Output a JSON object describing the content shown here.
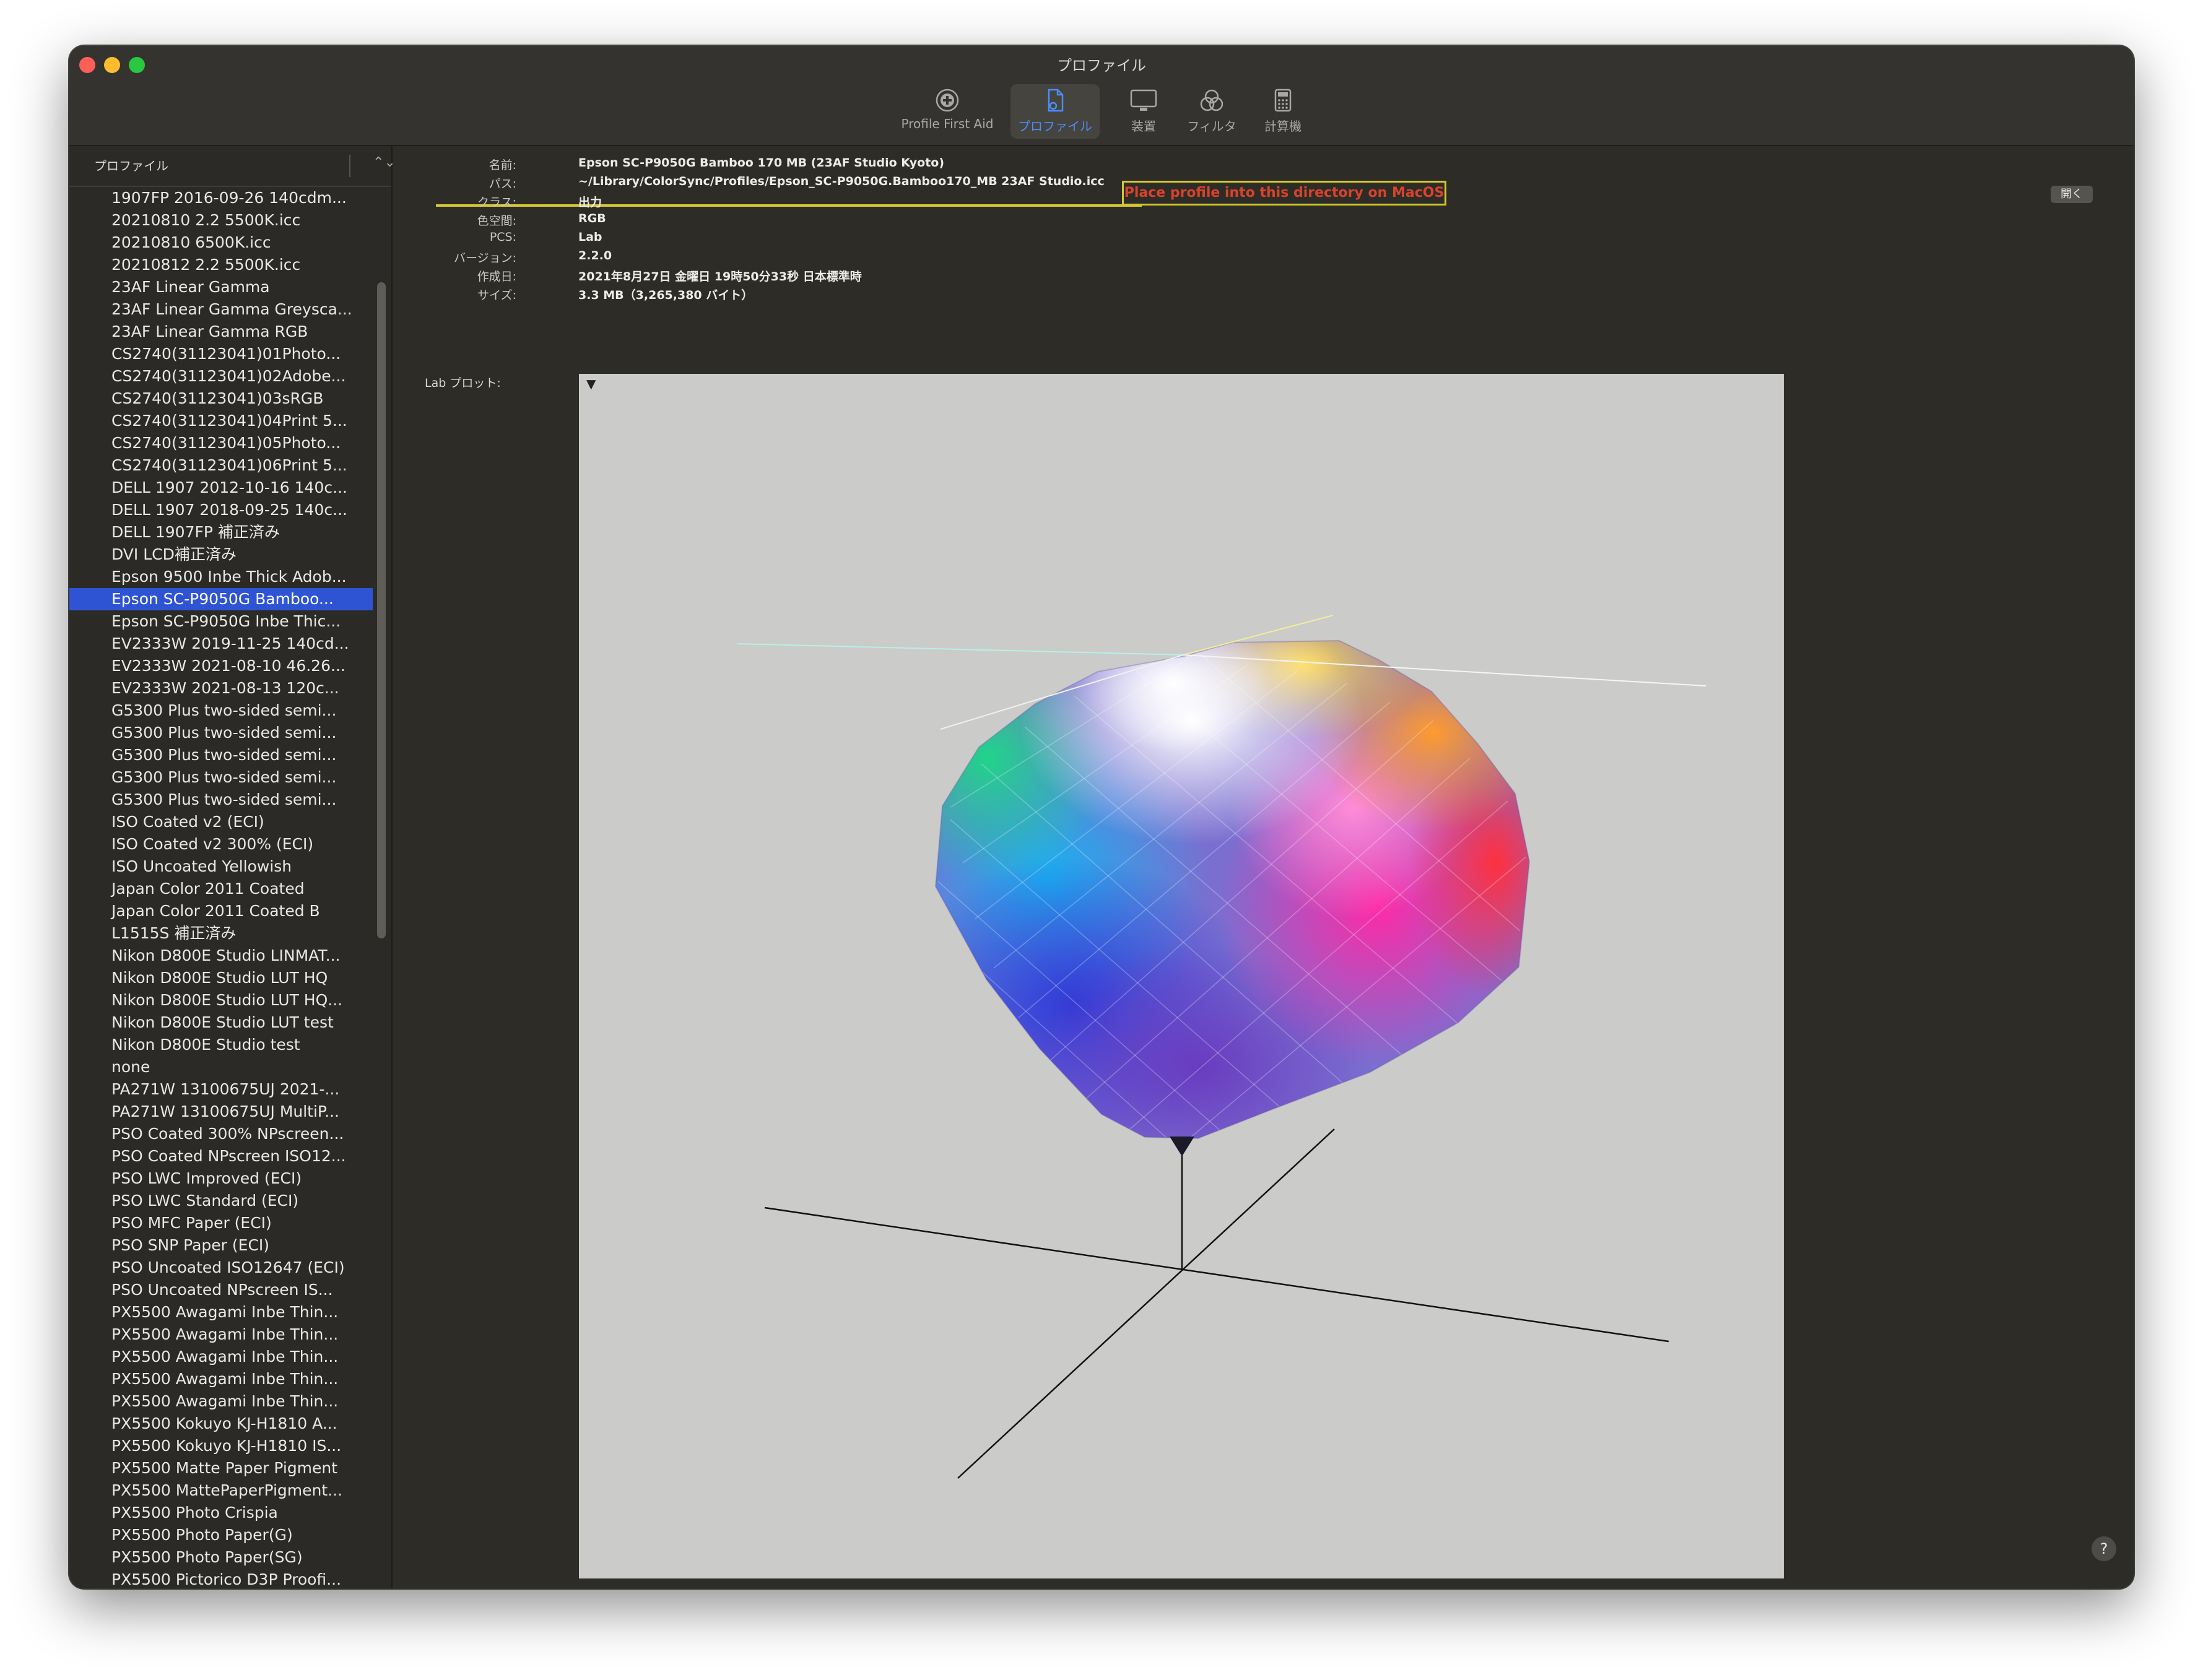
{
  "window": {
    "title": "プロファイル"
  },
  "toolbar": {
    "tools": [
      {
        "label": "Profile First Aid",
        "icon": "plus-circle-icon"
      },
      {
        "label": "プロファイル",
        "icon": "document-gear-icon",
        "active": true
      },
      {
        "label": "装置",
        "icon": "monitor-icon"
      },
      {
        "label": "フィルタ",
        "icon": "color-circles-icon"
      },
      {
        "label": "計算機",
        "icon": "calculator-icon"
      }
    ]
  },
  "sidebar": {
    "header": "プロファイル",
    "sort_icon": "up-down-chevron-icon",
    "selected_index": 18,
    "items": [
      "1907FP 2016-09-26 140cdm...",
      "20210810 2.2 5500K.icc",
      "20210810 6500K.icc",
      "20210812 2.2 5500K.icc",
      "23AF Linear Gamma",
      "23AF Linear Gamma Greysca...",
      "23AF Linear Gamma RGB",
      "CS2740(31123041)01Photo...",
      "CS2740(31123041)02Adobe...",
      "CS2740(31123041)03sRGB",
      "CS2740(31123041)04Print 5...",
      "CS2740(31123041)05Photo...",
      "CS2740(31123041)06Print 5...",
      "DELL 1907 2012-10-16 140c...",
      "DELL 1907 2018-09-25 140c...",
      "DELL 1907FP 補正済み",
      "DVI LCD補正済み",
      "Epson 9500 Inbe Thick Adob...",
      "Epson SC-P9050G Bamboo...",
      "Epson SC-P9050G Inbe Thic...",
      "EV2333W 2019-11-25 140cd...",
      "EV2333W 2021-08-10 46.26...",
      "EV2333W 2021-08-13 120c...",
      "G5300 Plus two-sided semi...",
      "G5300 Plus two-sided semi...",
      "G5300 Plus two-sided semi...",
      "G5300 Plus two-sided semi...",
      "G5300 Plus two-sided semi...",
      "ISO Coated v2 (ECI)",
      "ISO Coated v2 300% (ECI)",
      "ISO Uncoated Yellowish",
      "Japan Color 2011 Coated",
      "Japan Color 2011 Coated B",
      "L1515S 補正済み",
      "Nikon D800E Studio LINMAT...",
      "Nikon D800E Studio LUT HQ",
      "Nikon D800E Studio LUT HQ...",
      "Nikon D800E Studio LUT test",
      "Nikon D800E Studio test",
      "none",
      "PA271W 13100675UJ 2021-...",
      "PA271W 13100675UJ MultiP...",
      "PSO Coated 300% NPscreen...",
      "PSO Coated NPscreen ISO12...",
      "PSO LWC Improved (ECI)",
      "PSO LWC Standard (ECI)",
      "PSO MFC Paper (ECI)",
      "PSO SNP Paper (ECI)",
      "PSO Uncoated ISO12647 (ECI)",
      "PSO Uncoated NPscreen IS...",
      "PX5500 Awagami Inbe Thin...",
      "PX5500 Awagami Inbe Thin...",
      "PX5500 Awagami Inbe Thin...",
      "PX5500 Awagami Inbe Thin...",
      "PX5500 Awagami Inbe Thin...",
      "PX5500 Kokuyo KJ-H1810 A...",
      "PX5500 Kokuyo KJ-H1810 IS...",
      "PX5500 Matte Paper Pigment",
      "PX5500 MattePaperPigment...",
      "PX5500 Photo Crispia",
      "PX5500 Photo Paper(G)",
      "PX5500 Photo Paper(SG)",
      "PX5500 Pictorico D3P Proofi..."
    ]
  },
  "info": {
    "name_label": "名前:",
    "name_value": "Epson SC-P9050G Bamboo 170 MB (23AF Studio Kyoto)",
    "path_label": "パス:",
    "path_value": "~/Library/ColorSync/Profiles/Epson_SC-P9050G.Bamboo170_MB 23AF Studio.icc",
    "class_label": "クラス:",
    "class_value": "出力",
    "colorspace_label": "色空間:",
    "colorspace_value": "RGB",
    "pcs_label": "PCS:",
    "pcs_value": "Lab",
    "version_label": "バージョン:",
    "version_value": "2.2.0",
    "created_label": "作成日:",
    "created_value": "2021年8月27日 金曜日 19時50分33秒 日本標準時",
    "size_label": "サイズ:",
    "size_value": "3.3 MB（3,265,380 バイト）",
    "annotation": "Place profile into this directory on MacOS",
    "annotation_color": "#d8432c",
    "highlight_color": "#d4c832",
    "open_button": "開く"
  },
  "plot": {
    "label": "Lab プロット:",
    "menu_icon": "triangle-down-icon",
    "background": "#cbcbca"
  },
  "help": {
    "label": "?"
  },
  "colors": {
    "accent": "#4c8dff",
    "selection": "#2f54d3"
  }
}
